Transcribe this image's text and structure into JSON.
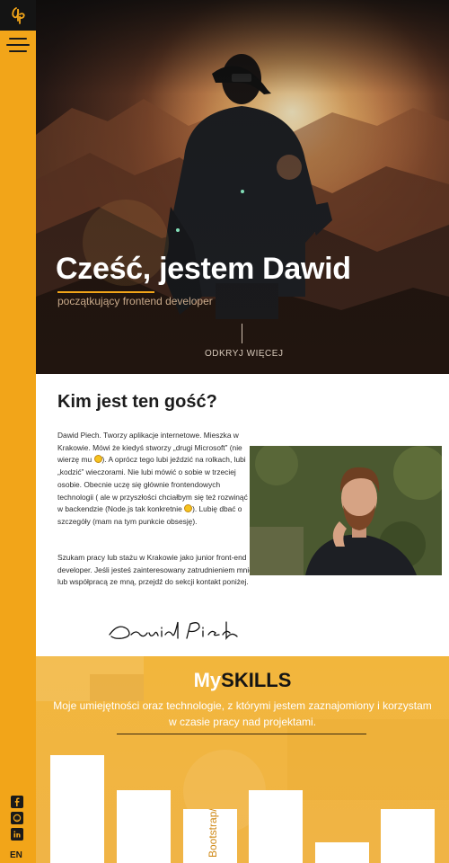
{
  "sidebar": {
    "logo_icon": "dp-logo",
    "menu_icon": "hamburger-icon",
    "social": [
      "facebook-icon",
      "github-icon",
      "linkedin-icon"
    ],
    "language": "EN"
  },
  "hero": {
    "title": "Cześć, jestem Dawid",
    "subtitle": "początkujący frontend developer",
    "cta": "ODKRYJ WIĘCEJ"
  },
  "about": {
    "title": "Kim jest ten gość?",
    "p1_a": "Dawid Piech. Tworzy aplikacje internetowe. Mieszka w Krakowie. Mówi że kiedyś stworzy „drugi Microsoft” (nie wierzę mu ",
    "p1_b": "). A oprócz tego lubi jeździć na rolkach, lubi „kodzić” wieczorami. Nie lubi mówić o sobie w trzeciej osobie. Obecnie uczę się głównie frontendowych technologii ( ale w przyszłości chciałbym się też rozwinąć w backendzie (Node.js tak konkretnie ",
    "p1_c": "). Lubię dbać o szczegóły (mam na tym punkcie obsesję).",
    "p2": "Szukam pracy lub stażu w Krakowie jako junior front-end developer. Jeśli jesteś zainteresowany zatrudnieniem mnie lub współpracą ze mną, przejdź do sekcji kontakt poniżej.",
    "signature": "Dawid Piech"
  },
  "skills": {
    "title_light": "My",
    "title_strong": "SKILLS",
    "description": "Moje umiejętności oraz technologie, z którymi jestem zaznajomiony i korzystam w czasie pracy nad projektami.",
    "bars": [
      {
        "label": "",
        "level": 0.92
      },
      {
        "label": "",
        "level": 0.62
      },
      {
        "label": "Bootstrap/Flex",
        "level": 0.46
      },
      {
        "label": "",
        "level": 0.62
      },
      {
        "label": "",
        "level": 0.18
      },
      {
        "label": "",
        "level": 0.46
      }
    ]
  },
  "colors": {
    "accent": "#f2a519",
    "dark": "#141414"
  }
}
